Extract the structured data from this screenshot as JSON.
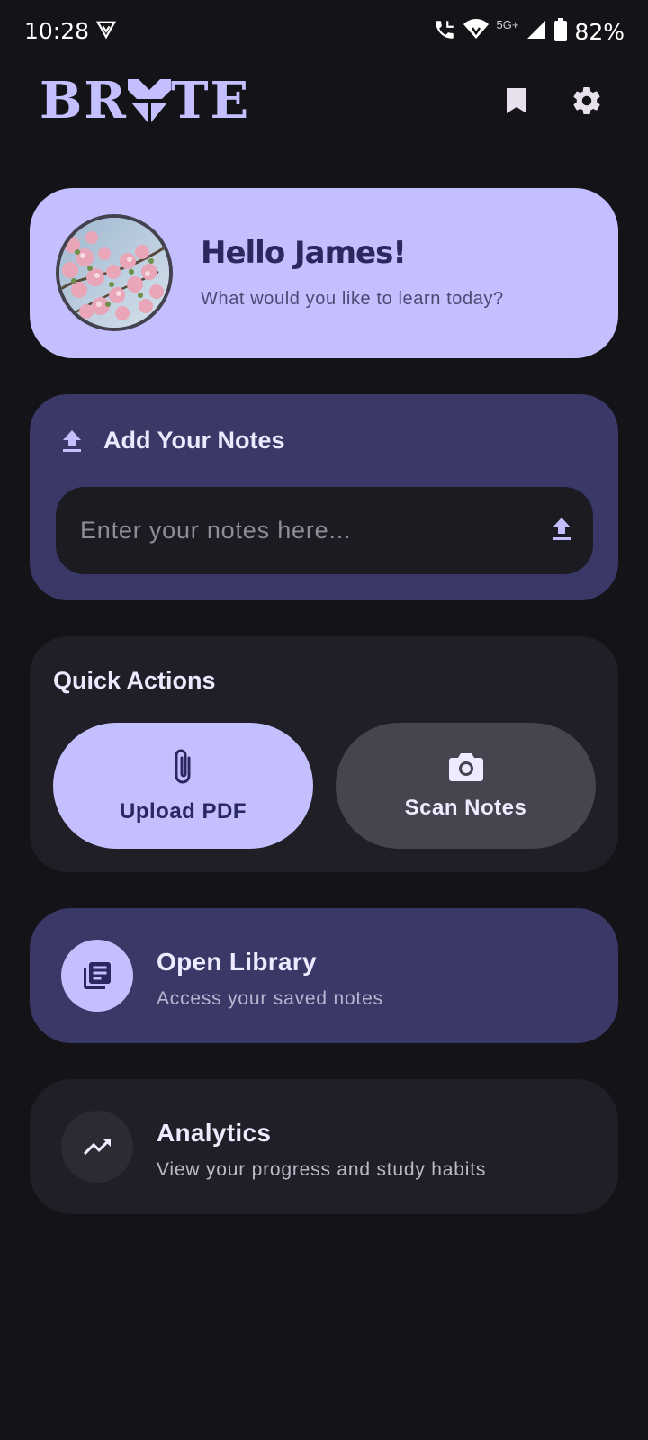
{
  "status_bar": {
    "time": "10:28",
    "network": "5G+",
    "battery": "82%"
  },
  "header": {
    "logo_text_left": "BR",
    "logo_text_right": "TE",
    "logo_alt": "BRUTE",
    "icons": [
      "bookmark-icon",
      "gear-icon"
    ]
  },
  "greeting": {
    "title": "Hello James!",
    "subtitle": "What would you like to learn today?"
  },
  "notes": {
    "label": "Add Your Notes",
    "placeholder": "Enter your notes here..."
  },
  "quick_actions": {
    "label": "Quick Actions",
    "upload_pdf": "Upload PDF",
    "scan_notes": "Scan Notes"
  },
  "library": {
    "title": "Open Library",
    "subtitle": "Access your saved notes"
  },
  "analytics": {
    "title": "Analytics",
    "subtitle": "View your progress and study habits"
  },
  "colors": {
    "background": "#141318",
    "accent": "#c4c0ff",
    "card_purple": "#393867",
    "card_dark": "#201e26"
  }
}
